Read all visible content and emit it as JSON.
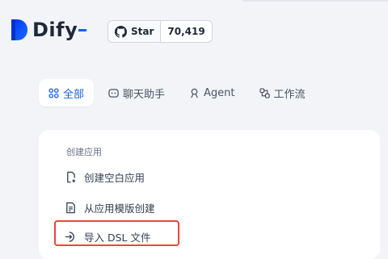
{
  "header": {
    "logo_text": "Dify",
    "github": {
      "star_label": "Star",
      "star_count": "70,419",
      "icon": "github-icon"
    }
  },
  "tabs": [
    {
      "label": "全部",
      "icon": "grid-icon",
      "active": true
    },
    {
      "label": "聊天助手",
      "icon": "chat-icon",
      "active": false
    },
    {
      "label": "Agent",
      "icon": "agent-icon",
      "active": false
    },
    {
      "label": "工作流",
      "icon": "workflow-icon",
      "active": false
    }
  ],
  "create_card": {
    "section_title": "创建应用",
    "items": [
      {
        "label": "创建空白应用",
        "icon": "file-plus-icon"
      },
      {
        "label": "从应用模版创建",
        "icon": "file-template-icon"
      },
      {
        "label": "导入 DSL 文件",
        "icon": "import-icon",
        "highlighted": true
      }
    ]
  },
  "colors": {
    "accent": "#155eef",
    "highlight": "#f04438",
    "background": "#f2f4f7"
  }
}
